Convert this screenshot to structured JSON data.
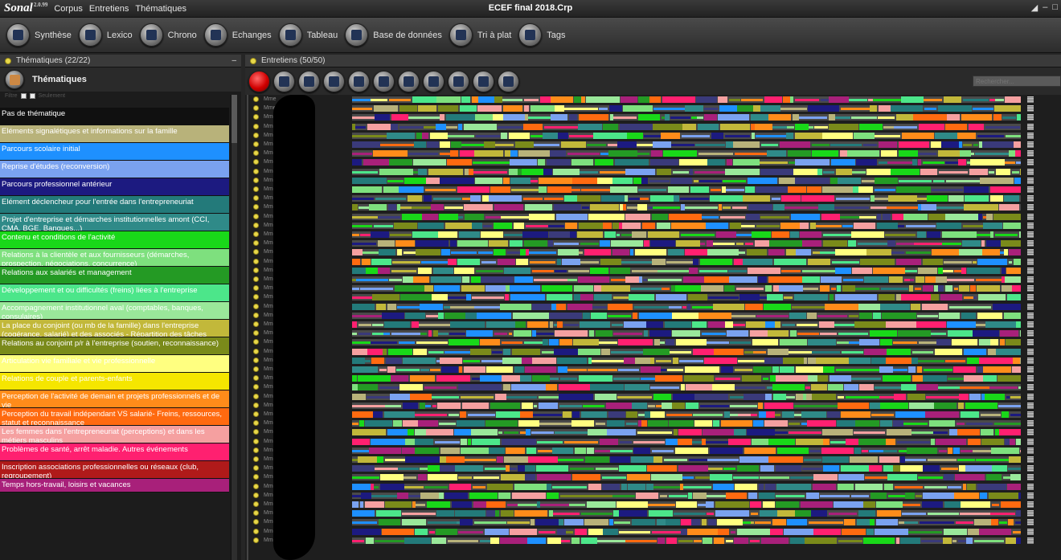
{
  "app": {
    "logo": "Sonal",
    "version": "2.0.99",
    "menus": [
      "Corpus",
      "Entretiens",
      "Thématiques"
    ],
    "window_title": "ECEF final 2018.Crp",
    "win_controls": [
      "◢",
      "–",
      "□"
    ]
  },
  "toolbar": [
    {
      "label": "Synthèse",
      "icon": "synthese-icon"
    },
    {
      "label": "Lexico",
      "icon": "lexico-icon"
    },
    {
      "label": "Chrono",
      "icon": "chrono-icon"
    },
    {
      "label": "Echanges",
      "icon": "echanges-icon"
    },
    {
      "label": "Tableau",
      "icon": "tableau-icon"
    },
    {
      "label": "Base de données",
      "icon": "database-icon"
    },
    {
      "label": "Tri à plat",
      "icon": "tri-icon"
    },
    {
      "label": "Tags",
      "icon": "tags-icon"
    }
  ],
  "left": {
    "header": "Thématiques (22/22)",
    "button": "Thématiques",
    "filter_label": "Filtre",
    "filter_only": "Seulement",
    "themes": [
      {
        "label": "Pas de thématique",
        "color": "#101010",
        "h": 22
      },
      {
        "label": "Eléments signalétiques  et informations sur la famille",
        "color": "#b8b27a",
        "h": 22
      },
      {
        "label": "Parcours scolaire initial",
        "color": "#1e90ff",
        "h": 22
      },
      {
        "label": "Reprise d'études (reconversion)",
        "color": "#7aa2f0",
        "h": 22
      },
      {
        "label": "Parcours professionnel antérieur",
        "color": "#1c1a80",
        "h": 22
      },
      {
        "label": "Elément déclencheur pour l'entrée dans l'entrepreneuriat",
        "color": "#237a7a",
        "h": 22
      },
      {
        "label": "Projet d'entreprise et démarches institutionnelles amont (CCI, CMA, BGE, Banques...)",
        "color": "#2f8a88",
        "h": 22
      },
      {
        "label": "Contenu et conditions de l'activité",
        "color": "#19d819",
        "h": 22
      },
      {
        "label": "Relations à la clientèle et aux fournisseurs (démarches, prospection, négociations, concurrence)",
        "color": "#7ee07e",
        "h": 22
      },
      {
        "label": "Relations aux salariés et management",
        "color": "#249a24",
        "h": 22
      },
      {
        "label": "Développement et ou difficultés (freins) liées à l'entreprise",
        "color": "#4ce68a",
        "h": 22
      },
      {
        "label": "Accompagnement institutionnel aval (comptables, banques, consulaires)",
        "color": "#9ae89a",
        "h": 22
      },
      {
        "label": "La place du conjoint (ou mb de la famille) dans l'entreprise (cogérance, salarié) et des associés - Répartition des tâches",
        "color": "#c2b83a",
        "h": 22
      },
      {
        "label": "Relations au conjoint p/r à l'entreprise (soutien, reconnaissance)",
        "color": "#7a8a1a",
        "h": 22
      },
      {
        "label": "Articulation vie familiale et vie professionnelle",
        "color": "#ffff80",
        "h": 22
      },
      {
        "label": "Relations de couple et parents-enfants",
        "color": "#f5e600",
        "h": 22
      },
      {
        "label": "Perception de l'activité de demain et projets professionnels et de vie",
        "color": "#ff8c1a",
        "h": 22
      },
      {
        "label": "Perception du travail indépendant VS salarié- Freins, ressources, statut et reconnaissance",
        "color": "#ff6a10",
        "h": 22
      },
      {
        "label": "Les femmes dans l'entrepreneuriat  (perceptions) et dans les métiers masculins",
        "color": "#f5a0a0",
        "h": 22
      },
      {
        "label": "Problèmes de santé, arrêt maladie. Autres événements",
        "color": "#ff2070",
        "h": 22
      },
      {
        "label": "Inscription associations professionnelles ou réseaux (club, regroupement)",
        "color": "#b01a1a",
        "h": 22
      },
      {
        "label": "Temps hors-travail, loisirs et vacances",
        "color": "#a8207a",
        "h": 17
      }
    ]
  },
  "right": {
    "header": "Entretiens (50/50)",
    "search_placeholder": "Rechercher...",
    "row_label": "Mme",
    "row_count": 50,
    "palette": [
      "#3a3a7a",
      "#4ce68a",
      "#19d819",
      "#7ee07e",
      "#249a24",
      "#2f8a88",
      "#9ae89a",
      "#f5a0a0",
      "#ff8c1a",
      "#b8b27a",
      "#ffff80",
      "#1e90ff",
      "#237a7a",
      "#7aa2f0",
      "#c2b83a",
      "#ff6a10",
      "#a8207a",
      "#ff2070",
      "#1c1a80",
      "#7a8a1a"
    ]
  }
}
